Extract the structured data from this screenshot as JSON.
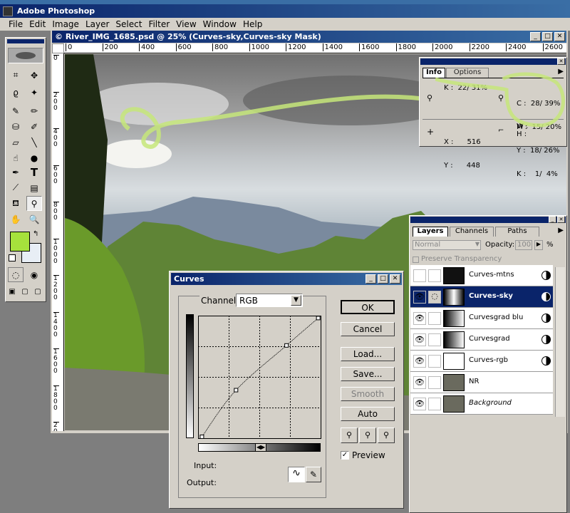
{
  "app": {
    "title": "Adobe Photoshop"
  },
  "menu": [
    "File",
    "Edit",
    "Image",
    "Layer",
    "Select",
    "Filter",
    "View",
    "Window",
    "Help"
  ],
  "document": {
    "title": "© River_IMG_1685.psd @ 25% (Curves-sky,Curves-sky Mask)",
    "ruler_h": [
      "0",
      "200",
      "400",
      "600",
      "800",
      "1000",
      "1200",
      "1400",
      "1600",
      "1800",
      "2000",
      "2200",
      "2400",
      "2600"
    ],
    "ruler_v": [
      "0",
      "200",
      "400",
      "600",
      "800",
      "1000",
      "1200",
      "1400",
      "1600",
      "1800",
      "2000"
    ]
  },
  "info": {
    "tabs": [
      "Info",
      "Options"
    ],
    "k1": "K :  22/ 31%",
    "c": "C :  28/ 39%",
    "m": "M :  15/ 20%",
    "y": "Y :  18/ 26%",
    "k2": "K :    1/  4%",
    "x": "X :      516",
    "ypos": "Y :      448",
    "w": "W :",
    "h": "H :"
  },
  "layers_panel": {
    "tabs": [
      "Layers",
      "Channels",
      "Paths"
    ],
    "mode": "Normal",
    "opacity_label": "Opacity:",
    "opacity": "100",
    "pct": "%",
    "preserve": "Preserve Transparency",
    "layers": [
      {
        "name": "Curves-mtns",
        "visible": false,
        "selected": false,
        "italic": false,
        "thumb": "#111"
      },
      {
        "name": "Curves-sky",
        "visible": true,
        "selected": true,
        "italic": false,
        "thumb": "#444"
      },
      {
        "name": "Curvesgrad blu",
        "visible": true,
        "selected": false,
        "italic": false,
        "thumb": "#777"
      },
      {
        "name": "Curvesgrad",
        "visible": true,
        "selected": false,
        "italic": false,
        "thumb": "#777"
      },
      {
        "name": "Curves-rgb",
        "visible": true,
        "selected": false,
        "italic": false,
        "thumb": "#fff"
      },
      {
        "name": "NR",
        "visible": true,
        "selected": false,
        "italic": false,
        "thumb": "#6a6a5e"
      },
      {
        "name": "Background",
        "visible": true,
        "selected": false,
        "italic": true,
        "thumb": "#6a6a5e"
      }
    ]
  },
  "curves": {
    "title": "Curves",
    "channel_label": "Channel:",
    "channel": "RGB",
    "ok": "OK",
    "cancel": "Cancel",
    "load": "Load...",
    "save": "Save...",
    "smooth": "Smooth",
    "auto": "Auto",
    "preview": "Preview",
    "input": "Input:",
    "output": "Output:",
    "points": [
      {
        "in": 8,
        "out": 3
      },
      {
        "in": 79,
        "out": 100
      },
      {
        "in": 184,
        "out": 193
      },
      {
        "in": 250,
        "out": 250
      }
    ]
  },
  "colors": {
    "foreground": "#a6e23c",
    "background": "#e8eef5"
  }
}
